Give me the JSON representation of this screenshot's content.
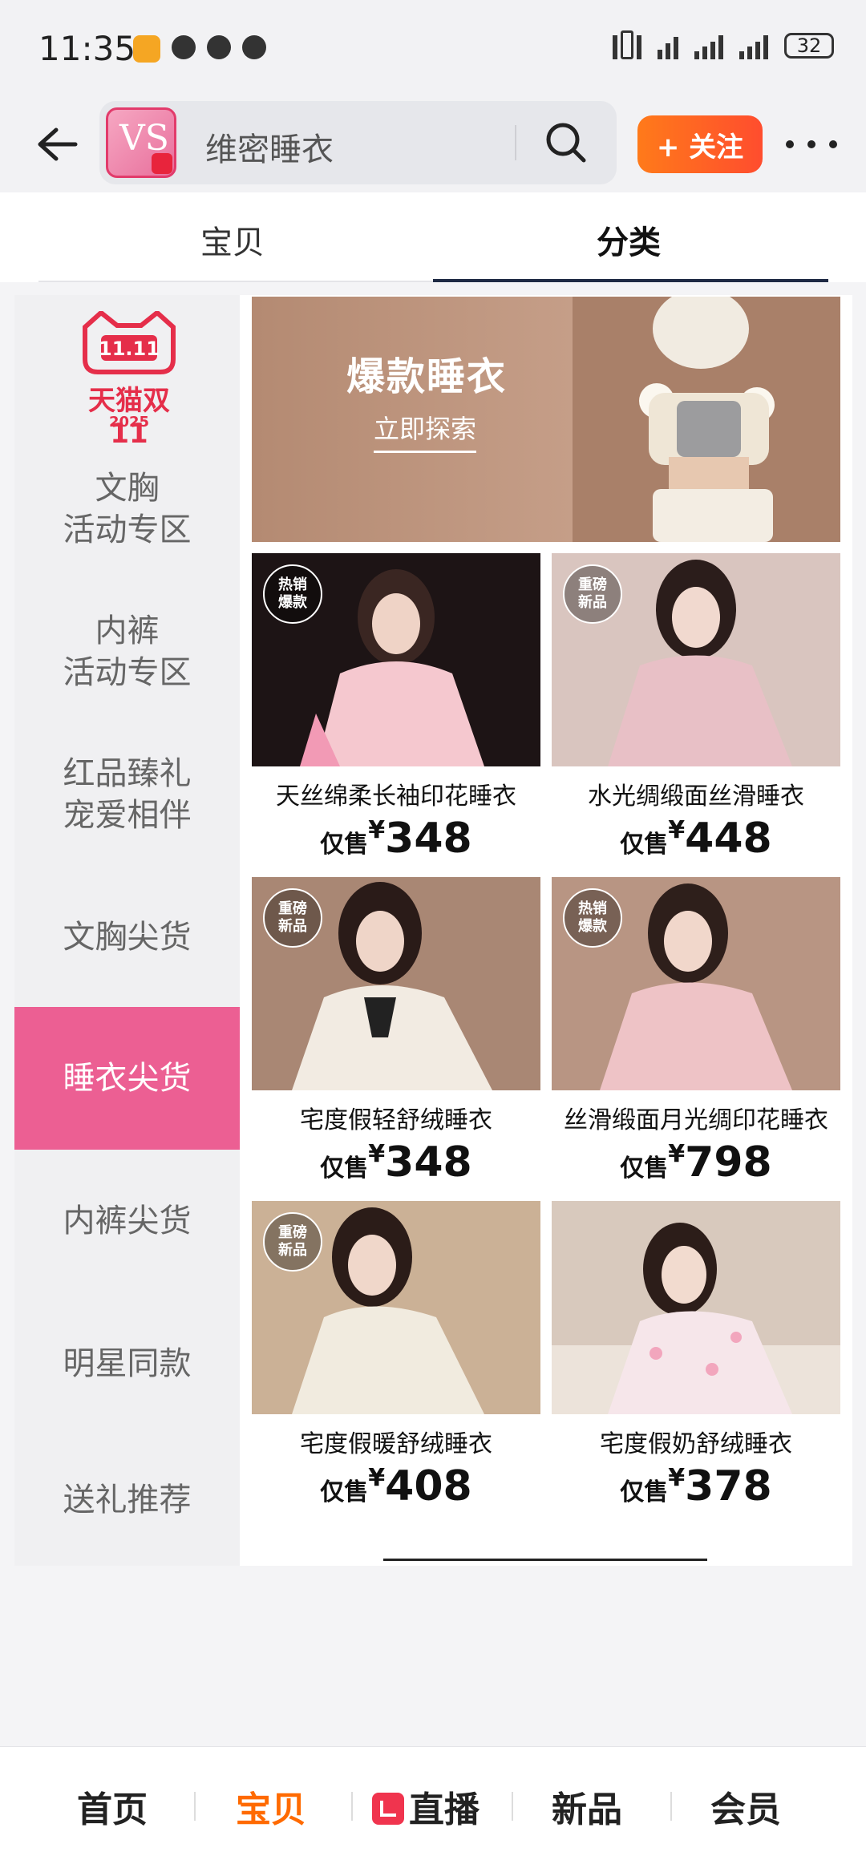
{
  "status_bar": {
    "time": "11:35",
    "battery": "32"
  },
  "header": {
    "brand_logo_text": "VS",
    "search_text": "维密睡衣",
    "follow_label": "+ 关注"
  },
  "tabs": [
    {
      "label": "宝贝"
    },
    {
      "label": "分类"
    }
  ],
  "sidebar": {
    "tmall_logo": {
      "top": "11.11",
      "title": "天猫双11",
      "year": "2025"
    },
    "items": [
      {
        "label": "文胸\n活动专区"
      },
      {
        "label": "内裤\n活动专区"
      },
      {
        "label": "红品臻礼\n宠爱相伴"
      },
      {
        "label": "文胸尖货"
      },
      {
        "label": "睡衣尖货"
      },
      {
        "label": "内裤尖货"
      },
      {
        "label": "明星同款"
      },
      {
        "label": "送礼推荐"
      }
    ],
    "active_item": "睡衣尖货"
  },
  "banner": {
    "title": "爆款睡衣",
    "link": "立即探索"
  },
  "products": [
    {
      "name": "天丝绵柔长袖印花睡衣",
      "price_prefix": "仅售",
      "currency": "¥",
      "price": "348",
      "tag": [
        "热销",
        "爆款"
      ]
    },
    {
      "name": "水光绸缎面丝滑睡衣",
      "price_prefix": "仅售",
      "currency": "¥",
      "price": "448",
      "tag": [
        "重磅",
        "新品"
      ]
    },
    {
      "name": "宅度假轻舒绒睡衣",
      "price_prefix": "仅售",
      "currency": "¥",
      "price": "348",
      "tag": [
        "重磅",
        "新品"
      ]
    },
    {
      "name": "丝滑缎面月光绸印花睡衣",
      "price_prefix": "仅售",
      "currency": "¥",
      "price": "798",
      "tag": [
        "热销",
        "爆款"
      ]
    },
    {
      "name": "宅度假暖舒绒睡衣",
      "price_prefix": "仅售",
      "currency": "¥",
      "price": "408",
      "tag": [
        "重磅",
        "新品"
      ]
    },
    {
      "name": "宅度假奶舒绒睡衣",
      "price_prefix": "仅售",
      "currency": "¥",
      "price": "378",
      "tag": []
    }
  ],
  "bottom_nav": [
    {
      "label": "首页"
    },
    {
      "label": "宝贝"
    },
    {
      "label": "直播"
    },
    {
      "label": "新品"
    },
    {
      "label": "会员"
    }
  ],
  "colors": {
    "accent_pink": "#ec5f93",
    "follow_orange": "#ff5a24",
    "nav_active": "#ff6a00",
    "tmall_red": "#e52e4a"
  }
}
